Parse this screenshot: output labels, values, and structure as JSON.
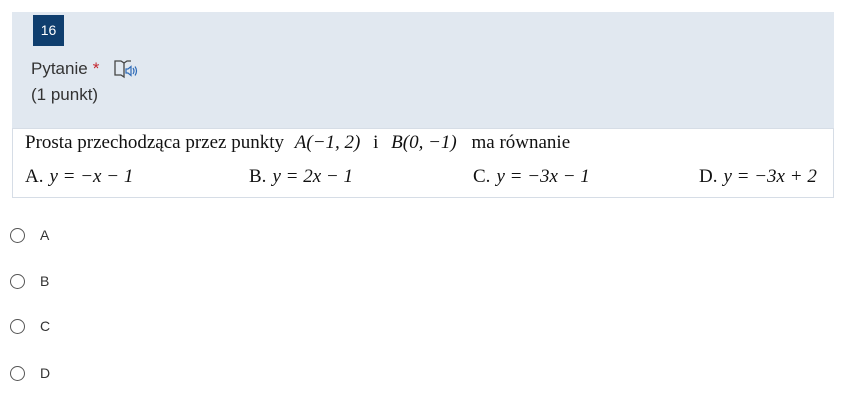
{
  "question": {
    "number": "16",
    "title": "Pytanie",
    "required_mark": "*",
    "points": "(1 punkt)",
    "reader_icon": "immersive-reader-icon"
  },
  "problem": {
    "stem_text": "Prosta przechodząca przez punkty",
    "point_a": "A(−1, 2)",
    "conjunction": "i",
    "point_b": "B(0, −1)",
    "stem_tail": "ma równanie",
    "options": [
      {
        "letter": "A.",
        "equation": "y = −x − 1"
      },
      {
        "letter": "B.",
        "equation": "y = 2x − 1"
      },
      {
        "letter": "C.",
        "equation": "y = −3x − 1"
      },
      {
        "letter": "D.",
        "equation": "y = −3x + 2"
      }
    ]
  },
  "choices": [
    {
      "label": "A"
    },
    {
      "label": "B"
    },
    {
      "label": "C"
    },
    {
      "label": "D"
    }
  ],
  "colors": {
    "card_bg": "#e1e8f0",
    "badge_bg": "#0f3e6e",
    "required": "#c4262e"
  }
}
